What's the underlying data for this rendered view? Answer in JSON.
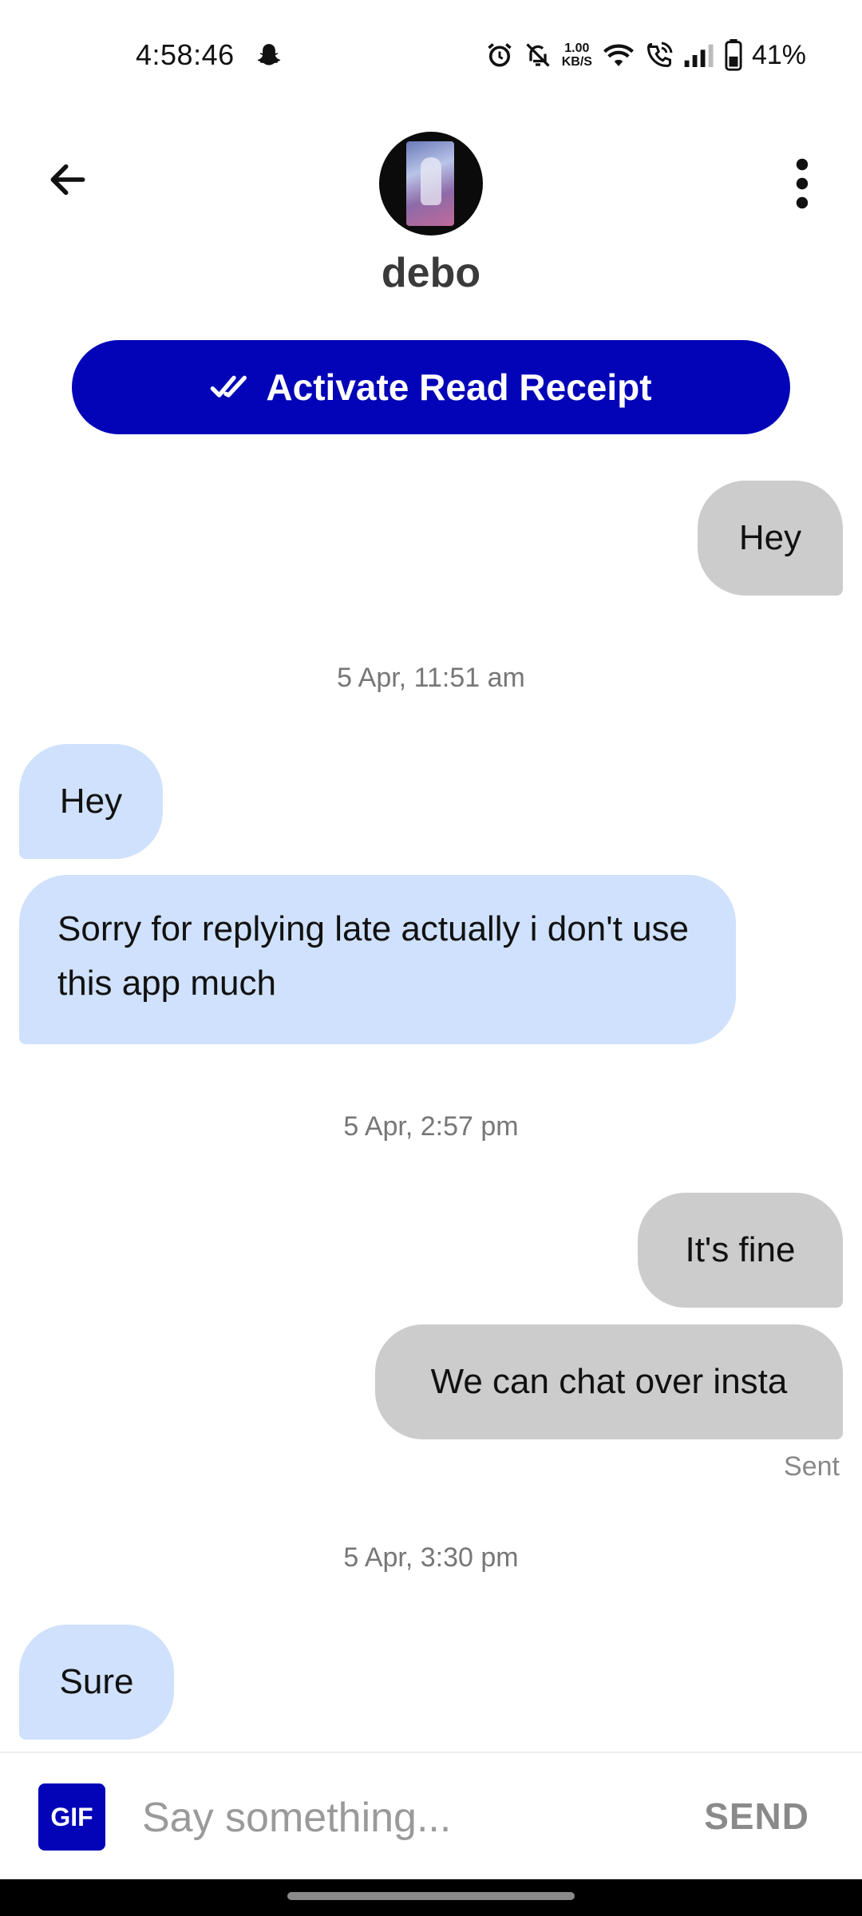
{
  "status_bar": {
    "time": "4:58:46",
    "net_speed_value": "1.00",
    "net_speed_unit": "KB/S",
    "battery": "41%"
  },
  "header": {
    "contact_name": "debo",
    "back_icon": "arrow-left-icon",
    "menu_icon": "more-vertical-icon"
  },
  "read_receipt_button": {
    "label": "Activate Read Receipt",
    "icon": "double-check-icon",
    "color": "#0303b8"
  },
  "messages": [
    {
      "direction": "out",
      "text": "Hey"
    },
    {
      "type": "timestamp",
      "text": "5 Apr, 11:51 am"
    },
    {
      "direction": "in",
      "text": "Hey"
    },
    {
      "direction": "in",
      "text": "Sorry for replying late actually i don't use this app much"
    },
    {
      "type": "timestamp",
      "text": "5 Apr, 2:57 pm"
    },
    {
      "direction": "out",
      "text": "It's fine"
    },
    {
      "direction": "out",
      "text": "We can chat over insta"
    },
    {
      "type": "status",
      "text": "Sent"
    },
    {
      "type": "timestamp",
      "text": "5 Apr, 3:30 pm"
    },
    {
      "direction": "in",
      "text": "Sure"
    }
  ],
  "composer": {
    "gif_label": "GIF",
    "placeholder": "Say something...",
    "value": "",
    "send_label": "SEND"
  },
  "colors": {
    "accent": "#0303b8",
    "incoming_bubble": "#cfe1fc",
    "outgoing_bubble": "#cccccc"
  }
}
